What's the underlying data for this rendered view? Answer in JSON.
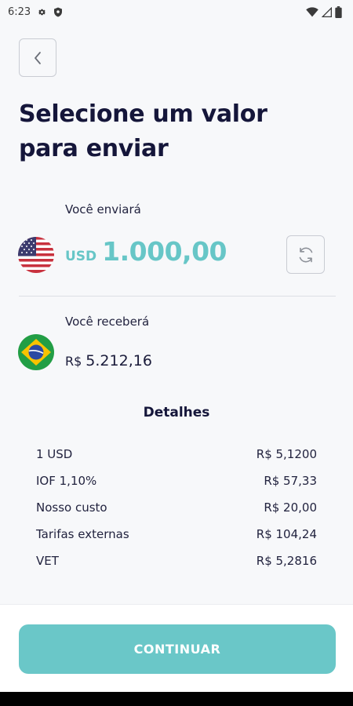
{
  "status_bar": {
    "time": "6:23"
  },
  "header": {
    "title": "Selecione um valor para enviar"
  },
  "send": {
    "label": "Você enviará",
    "currency": "USD",
    "amount": "1.000,00",
    "flag": "us-flag-icon"
  },
  "receive": {
    "label": "Você receberá",
    "currency": "R$",
    "amount": "5.212,16",
    "flag": "brazil-flag-icon"
  },
  "details": {
    "title": "Detalhes",
    "rows": [
      {
        "label": "1 USD",
        "value": "R$ 5,1200"
      },
      {
        "label": "IOF 1,10%",
        "value": "R$ 57,33"
      },
      {
        "label": "Nosso custo",
        "value": "R$ 20,00"
      },
      {
        "label": "Tarifas externas",
        "value": "R$ 104,24"
      },
      {
        "label": "VET",
        "value": "R$ 5,2816"
      }
    ]
  },
  "footer": {
    "continue_label": "CONTINUAR"
  },
  "colors": {
    "accent": "#6ac7c8",
    "amount": "#67c6c7",
    "title": "#15163a"
  }
}
